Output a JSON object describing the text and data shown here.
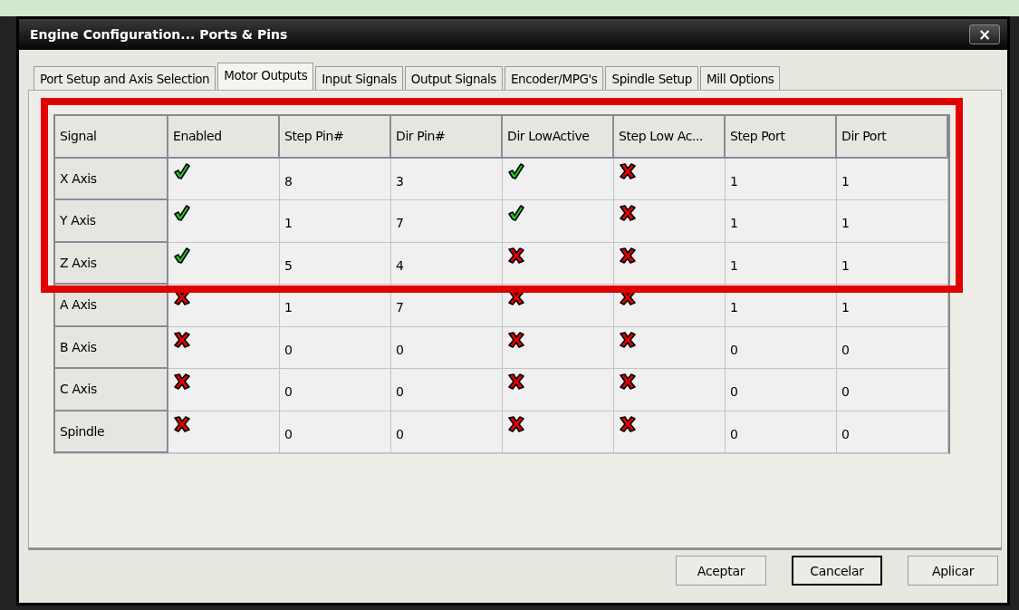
{
  "window": {
    "title": "Engine Configuration... Ports & Pins",
    "close": "×"
  },
  "tabs": [
    {
      "label": "Port Setup and Axis Selection",
      "selected": false
    },
    {
      "label": "Motor Outputs",
      "selected": true
    },
    {
      "label": "Input Signals",
      "selected": false
    },
    {
      "label": "Output Signals",
      "selected": false
    },
    {
      "label": "Encoder/MPG's",
      "selected": false
    },
    {
      "label": "Spindle Setup",
      "selected": false
    },
    {
      "label": "Mill Options",
      "selected": false
    }
  ],
  "table": {
    "columns": [
      {
        "label": "Signal",
        "kind": "name"
      },
      {
        "label": "Enabled",
        "kind": "check"
      },
      {
        "label": "Step Pin#",
        "kind": "text"
      },
      {
        "label": "Dir Pin#",
        "kind": "text"
      },
      {
        "label": "Dir LowActive",
        "kind": "check"
      },
      {
        "label": "Step Low Ac...",
        "kind": "check"
      },
      {
        "label": "Step Port",
        "kind": "text"
      },
      {
        "label": "Dir Port",
        "kind": "text"
      }
    ],
    "rows": [
      {
        "cells": [
          {
            "text": "X Axis"
          },
          {
            "checked": true
          },
          {
            "text": "8"
          },
          {
            "text": "3"
          },
          {
            "checked": true
          },
          {
            "checked": false
          },
          {
            "text": "1"
          },
          {
            "text": "1"
          }
        ]
      },
      {
        "cells": [
          {
            "text": "Y Axis"
          },
          {
            "checked": true
          },
          {
            "text": "1"
          },
          {
            "text": "7"
          },
          {
            "checked": true
          },
          {
            "checked": false
          },
          {
            "text": "1"
          },
          {
            "text": "1"
          }
        ]
      },
      {
        "cells": [
          {
            "text": "Z Axis"
          },
          {
            "checked": true
          },
          {
            "text": "5"
          },
          {
            "text": "4"
          },
          {
            "checked": false
          },
          {
            "checked": false
          },
          {
            "text": "1"
          },
          {
            "text": "1"
          }
        ]
      },
      {
        "cells": [
          {
            "text": "A Axis"
          },
          {
            "checked": false
          },
          {
            "text": "1"
          },
          {
            "text": "7"
          },
          {
            "checked": false
          },
          {
            "checked": false
          },
          {
            "text": "1"
          },
          {
            "text": "1"
          }
        ]
      },
      {
        "cells": [
          {
            "text": "B Axis"
          },
          {
            "checked": false
          },
          {
            "text": "0"
          },
          {
            "text": "0"
          },
          {
            "checked": false
          },
          {
            "checked": false
          },
          {
            "text": "0"
          },
          {
            "text": "0"
          }
        ]
      },
      {
        "cells": [
          {
            "text": "C Axis"
          },
          {
            "checked": false
          },
          {
            "text": "0"
          },
          {
            "text": "0"
          },
          {
            "checked": false
          },
          {
            "checked": false
          },
          {
            "text": "0"
          },
          {
            "text": "0"
          }
        ]
      },
      {
        "cells": [
          {
            "text": "Spindle"
          },
          {
            "checked": false
          },
          {
            "text": "0"
          },
          {
            "text": "0"
          },
          {
            "checked": false
          },
          {
            "checked": false
          },
          {
            "text": "0"
          },
          {
            "text": "0"
          }
        ]
      }
    ]
  },
  "buttons": [
    {
      "label": "Aceptar",
      "selected": false
    },
    {
      "label": "Cancelar",
      "selected": true
    },
    {
      "label": "Aplicar",
      "selected": false
    }
  ]
}
